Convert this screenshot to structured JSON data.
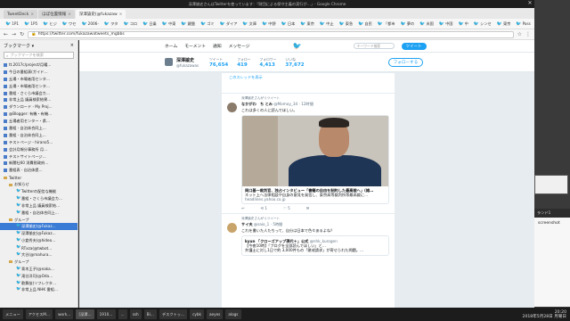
{
  "window": {
    "title": "深澤諭史さんはTwitterを使っています：「財団による保守主義の実行が…」- Google Chrome"
  },
  "tabs": [
    {
      "label": "TweetDeck",
      "active": false
    },
    {
      "label": "ほぼ位置情報",
      "active": false
    },
    {
      "label": "深澤諭史(@fukazaw",
      "active": true
    }
  ],
  "bookmarks": [
    "1P1",
    "1P5",
    "ヒジ",
    "ワセ",
    "2006-",
    "ヲタ",
    "コロ",
    "日乗",
    "中東",
    "鍵盤",
    "ゴミ",
    "ダイア",
    "文庫",
    "中野",
    "日本",
    "東京",
    "中止",
    "東急",
    "自民",
    "「都市",
    "夢の",
    "米国",
    "中国",
    "中",
    "シンセ",
    "東京",
    "Pass",
    "アメ"
  ],
  "address": {
    "url": "https://twitter.com/fukazawatweets_mgbbs"
  },
  "sidebar": {
    "header": "ブックマーク ▾",
    "search_placeholder": "ブックマークを検索",
    "items": [
      {
        "label": "tt.2017c/project/月曜…",
        "level": 0,
        "icon": "page"
      },
      {
        "label": "今日の番組表(ガイド…",
        "level": 0,
        "icon": "page"
      },
      {
        "label": "丘場・市場者用センタ…",
        "level": 0,
        "icon": "page"
      },
      {
        "label": "丘場・市場者用センタ…",
        "level": 0,
        "icon": "page"
      },
      {
        "label": "番組 - さくら市議会カ…",
        "level": 0,
        "icon": "page"
      },
      {
        "label": "非常上品 議員検索結果…",
        "level": 0,
        "icon": "page"
      },
      {
        "label": "ダウンロード - My Proj…",
        "level": 0,
        "icon": "page"
      },
      {
        "label": "@Blogger: 有機・有機…",
        "level": 0,
        "icon": "page"
      },
      {
        "label": "丘場者用センター・県…",
        "level": 0,
        "icon": "page"
      },
      {
        "label": "番組 - 自治体合同上…",
        "level": 0,
        "icon": "page"
      },
      {
        "label": "番組 - 自治体合同上…",
        "level": 0,
        "icon": "page"
      },
      {
        "label": "テストページ - hirano5…",
        "level": 0,
        "icon": "page"
      },
      {
        "label": "会計月報分事務所 月…",
        "level": 0,
        "icon": "page"
      },
      {
        "label": "テストサイトページ…",
        "level": 0,
        "icon": "page"
      },
      {
        "label": "新聞社60 消費税政府…",
        "level": 0,
        "icon": "page"
      },
      {
        "label": "番組表 - 自治体提…",
        "level": 0,
        "icon": "page"
      },
      {
        "label": "Twitter",
        "level": 0,
        "icon": "folder"
      },
      {
        "label": "お知らせ",
        "level": 1,
        "icon": "folder"
      },
      {
        "label": "Twitterの配信な機能",
        "level": 2,
        "icon": "tw"
      },
      {
        "label": "番組・さくら市議会カ…",
        "level": 2,
        "icon": "tw"
      },
      {
        "label": "非常上品 議員検索結…",
        "level": 2,
        "icon": "tw"
      },
      {
        "label": "番組・自治体合同上…",
        "level": 2,
        "icon": "tw"
      },
      {
        "label": "グループ",
        "level": 1,
        "icon": "folder"
      },
      {
        "label": "深澤諭史(@Fukaz…",
        "level": 2,
        "icon": "tw",
        "selected": true
      },
      {
        "label": "深澤諭史(@Fukaz…",
        "level": 2,
        "icon": "tw"
      },
      {
        "label": "小倉秀夫(@hideo…",
        "level": 2,
        "icon": "tw"
      },
      {
        "label": "RTxza(@twbot…",
        "level": 2,
        "icon": "tw"
      },
      {
        "label": "大谷(@mahura…",
        "level": 2,
        "icon": "tw"
      },
      {
        "label": "グループ",
        "level": 1,
        "icon": "folder"
      },
      {
        "label": "青木王子(@naka…",
        "level": 2,
        "icon": "tw"
      },
      {
        "label": "滝谷洋司(@Oda…",
        "level": 2,
        "icon": "tw"
      },
      {
        "label": "歌舞伎(ソフレクタ…",
        "level": 2,
        "icon": "tw"
      },
      {
        "label": "非常上品 NHK 番組…",
        "level": 2,
        "icon": "tw"
      }
    ]
  },
  "twitter_nav": {
    "home": "ホーム",
    "moments": "モーメント",
    "notifications": "通知",
    "messages": "メッセージ",
    "search_placeholder": "キーワード検索",
    "tweet_button": "ツイート"
  },
  "profile": {
    "name": "深澤諭史",
    "screen_name": "@fukazawas",
    "stats": [
      {
        "label": "ツイート",
        "value": "76,654"
      },
      {
        "label": "フォロー",
        "value": "419"
      },
      {
        "label": "フォロワー",
        "value": "4,413"
      },
      {
        "label": "いいね",
        "value": "37,672"
      }
    ],
    "follow_button": "フォローする"
  },
  "timeline": {
    "thread_link": "このスレッドを表示",
    "tweet1": {
      "rt_note": "深澤諭史さんがリツイート",
      "name": "なかがわ　ち とみ",
      "screen_name": "@Momoy_34 · 12時間",
      "body": "これは多くの人に読んでほしい。",
      "card_title": "岡口基一裁判官、独占インタビュー「書籍の自由を制約した最高裁へ」(雑…",
      "card_desc": "ネット上へ法律相談や自身の意見を発信し、東京高等裁判所等最高裁に…",
      "card_domain": "headlines.yahoo.co.jp",
      "actions": [
        "↩",
        "⟲ 1",
        "♡ 5",
        "✉"
      ]
    },
    "tweet2": {
      "rt_note": "深澤諭史さんがリツイート",
      "name": "サイ夫",
      "screen_name": "@saio_1 · 5時間",
      "body": "これを書いた人たちって、自分は日本で色々あるよね？",
      "quote_name": "kyun 「クローズアップ現代＋」公式",
      "quote_sn": "@nhk_kurogen",
      "quote_body": "【今夜10時】「ブログを全部読んでほしい」と…",
      "quote_more": "弁護士に対し1日で約 3,000件もの「懲戒請求」が寄せられた問題。…"
    }
  },
  "right_panel": {
    "title": "ランド1",
    "content": "screenshot"
  },
  "taskbar": {
    "items": [
      "メニュー",
      "アクセスM…",
      "work…",
      "[深澤…",
      "1910…",
      "…",
      "ssh",
      "Bi…",
      "デスクトッ…",
      "cybk",
      "aeyes",
      "alogs"
    ],
    "clock_time": "20:20",
    "clock_date": "2018年5月28日 月曜日"
  }
}
